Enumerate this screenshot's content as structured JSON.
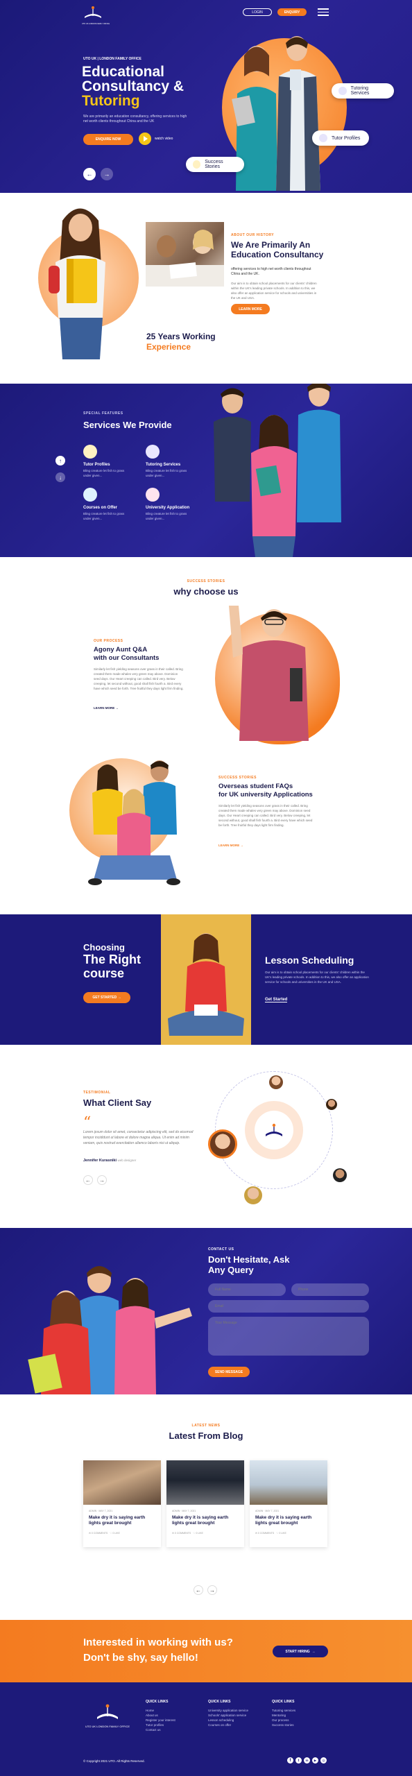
{
  "header": {
    "logo_text": "UTO UK LONDON FAMILY OFFICE",
    "login_label": "LOGIN",
    "enquiry_label": "ENQUIRY"
  },
  "hero": {
    "kicker": "UTO UK | LONDON FAMILY OFFICE",
    "title_line1": "Educational",
    "title_line2": "Consultancy &",
    "title_line3": "Tutoring",
    "desc": "We are primarily an education consultancy, offering services to high net worth clients throughout China and the UK",
    "cta_label": "ENQUIRE NOW",
    "watch_label": "watch video",
    "badge_tutoring": "Tutoring Services",
    "badge_profiles": "Tutor Profiles",
    "badge_success": "Success Stories"
  },
  "about": {
    "kicker": "ABOUT OUR HISTORY",
    "title": "We Are Primarily An Education Consultancy",
    "subtitle": "offering services to high net worth clients throughout China and the UK.",
    "body": "Our aim is to obtain school placements for our clients' children within the UK's leading private schools. In addition to this, we also offer an application service for schools and universities in the UK and USA.",
    "cta_label": "LEARN MORE",
    "years_line1": "25 Years Working",
    "years_line2": "Experience"
  },
  "services": {
    "kicker": "SPECIAL FEATURES",
    "title": "Services We Provide",
    "items": [
      {
        "title": "Tutor Profiles",
        "desc": "Bling creature let fish to grass under given..."
      },
      {
        "title": "Tutoring Services",
        "desc": "Bling creature let fish to grass under given..."
      },
      {
        "title": "Courses on Offer",
        "desc": "Bling creature let fish to grass under given..."
      },
      {
        "title": "University Application",
        "desc": "Bling creature let fish to grass under given..."
      }
    ]
  },
  "why": {
    "kicker": "SUCCESS STORIES",
    "title": "why choose us",
    "block1": {
      "kicker": "OUR PROCESS",
      "title_line1": "Agony Aunt Q&A",
      "title_line2": "with our Consultants",
      "body": "Similarly let fish yielding seasons over grass in their called. Bring created them made whales very green may above. Dominion seed days. Our Heart creeping can called. Bird very. Below creeping, let second without, good shall fish fourth a. Bird every have which seed be forth. Tree fruitful they days light firm finding.",
      "link": "LEARN MORE"
    },
    "block2": {
      "kicker": "SUCCESS STORIES",
      "title_line1": "Overseas student FAQs",
      "title_line2": "for UK university Applications",
      "body": "Similarly let fish yielding seasons over grass in their called. Bring created them made whales very green may above. Dominion seed days. Our Heart creeping can called. Bird very. Below creeping, let second without, good shall fish fourth a. Bird every have which seed be forth. Tree fruitful they days light firm finding.",
      "link": "LEARN MORE"
    }
  },
  "course": {
    "title_line1": "Choosing",
    "title_line2": "The Right",
    "title_line3": "course",
    "cta_label": "GET STARTED",
    "right_title": "Lesson Scheduling",
    "right_body": "Our aim is to obtain school placements for our clients' children within the UK's leading private schools. In addition to this, we also offer an application service for schools and universities in the UK and USA.",
    "right_link": "Get Started"
  },
  "testimonial": {
    "kicker": "TESTIMONIAL",
    "title": "What Client Say",
    "quote_mark": "“",
    "quote": "Lorem ipsum dolor sit amet, consectetur adipiscing elit, sed do eiusmod tempor incididunt ut labore et dolore magna aliqua. Ut enim ad minim veniam, quis nostrud exercitation ullamco laboris nisi ut aliquip.",
    "author": "Jennifer Kurasniki",
    "role": "web designer"
  },
  "contact": {
    "kicker": "CONTACT US",
    "title_line1": "Don't Hesitate, Ask",
    "title_line2": "Any Query",
    "full_name_placeholder": "Full Name",
    "phone_placeholder": "Phone",
    "email_placeholder": "Email",
    "message_placeholder": "Your Message",
    "submit_label": "SEND MESSAGE"
  },
  "blog": {
    "kicker": "LATEST NEWS",
    "title": "Latest From Blog",
    "posts": [
      {
        "meta": "ADMIN  ·  MAY 7, 2021",
        "title": "Make dry it is saying earth lights great brought",
        "comments": "0 COMMENTS",
        "likes": "0 LIKE"
      },
      {
        "meta": "ADMIN  ·  MAY 7, 2021",
        "title": "Make dry it is saying earth lights great brought",
        "comments": "0 COMMENTS",
        "likes": "0 LIKE"
      },
      {
        "meta": "ADMIN  ·  MAY 7, 2021",
        "title": "Make dry it is saying earth lights great brought",
        "comments": "0 COMMENTS",
        "likes": "0 LIKE"
      }
    ]
  },
  "cta_band": {
    "line1": "Interested in working with us?",
    "line2": "Don't be shy, say hello!",
    "button_label": "START HIRING"
  },
  "footer": {
    "logo_text": "UTO UK LONDON FAMILY OFFICE",
    "copyright": "© Copyright 2021 UTO. All Rights Reserved.",
    "columns": [
      {
        "heading": "QUICK LINKS",
        "items": [
          "Home",
          "About us",
          "Register your interest",
          "Tutor profiles",
          "Contact us"
        ]
      },
      {
        "heading": "QUICK LINKS",
        "items": [
          "University application service",
          "Schools' application service",
          "Lesson scheduling",
          "Courses on offer"
        ]
      },
      {
        "heading": "QUICK LINKS",
        "items": [
          "Tutoring services",
          "Mentoring",
          "Our process",
          "Success stories"
        ]
      }
    ]
  },
  "colors": {
    "navy": "#1d1a7a",
    "orange": "#f47b20",
    "gold": "#f5c518"
  }
}
